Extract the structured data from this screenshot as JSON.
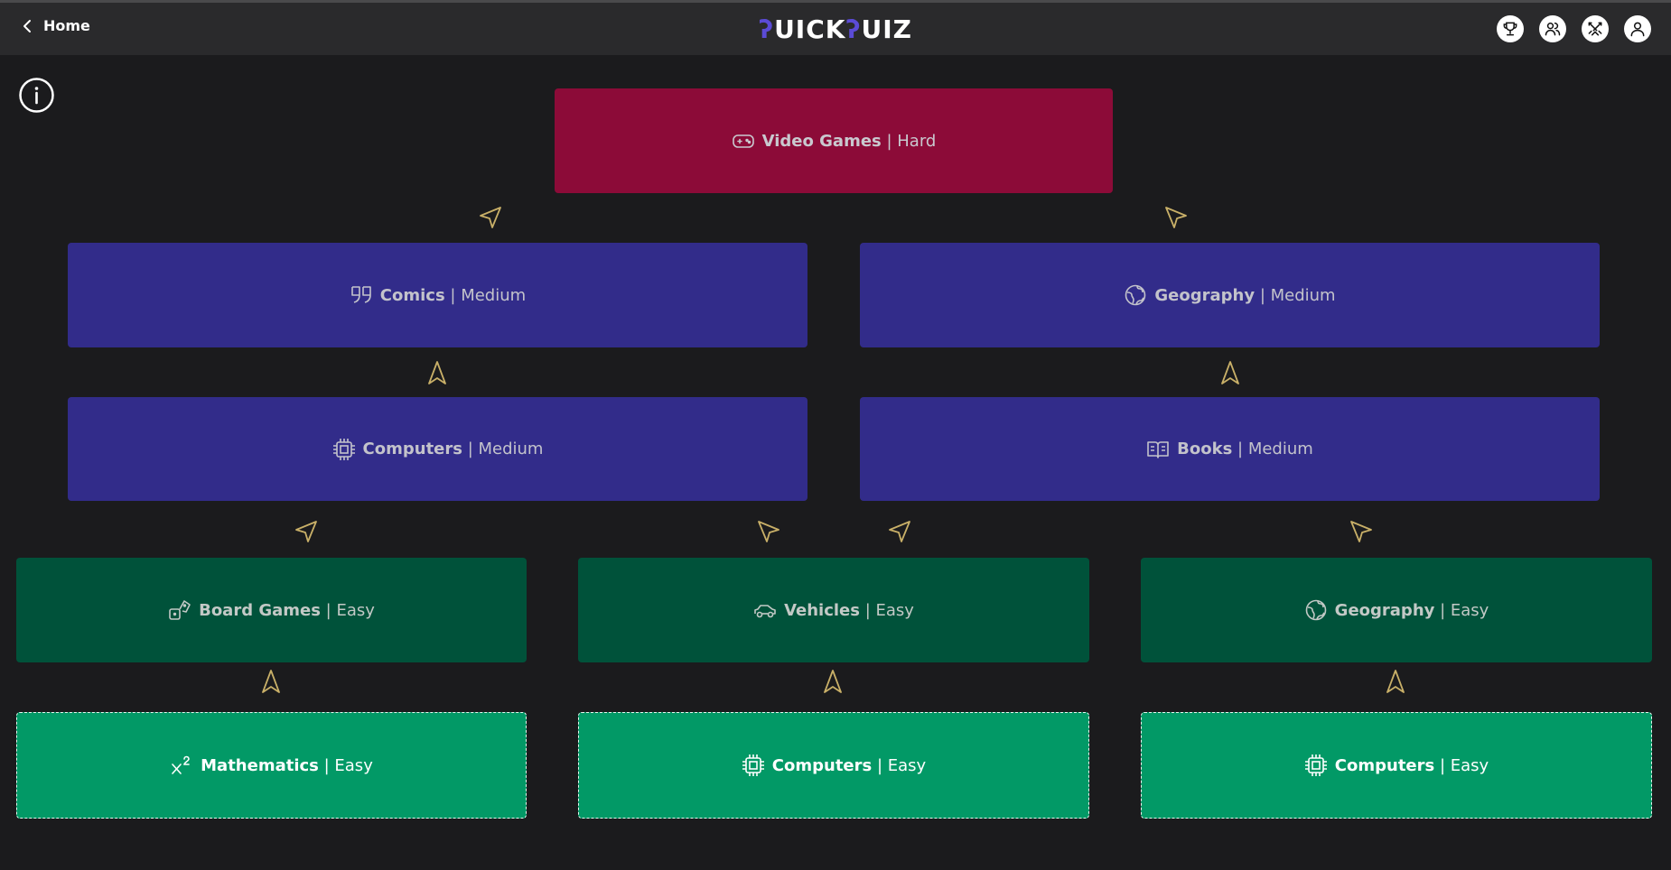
{
  "header": {
    "home_label": "Home",
    "logo": {
      "q1": "ʔ",
      "part1": "UICK",
      "q2": "ʔ",
      "part2": "UIZ"
    },
    "nav_icons": [
      "trophy-icon",
      "users-icon",
      "swords-icon",
      "user-icon"
    ]
  },
  "colors": {
    "hard": "#8c0b38",
    "medium": "#322c8a",
    "easy": "#00523a",
    "start": "#029966",
    "arrow": "#c9b068",
    "accent": "#5b4bd6"
  },
  "nodes": {
    "video_games": {
      "name": "Video Games",
      "level": "Hard",
      "icon": "gamepad-icon"
    },
    "comics": {
      "name": "Comics",
      "level": "Medium",
      "icon": "quote-icon"
    },
    "geography_med": {
      "name": "Geography",
      "level": "Medium",
      "icon": "globe-icon"
    },
    "computers_med": {
      "name": "Computers",
      "level": "Medium",
      "icon": "cpu-icon"
    },
    "books": {
      "name": "Books",
      "level": "Medium",
      "icon": "book-icon"
    },
    "board_games": {
      "name": "Board Games",
      "level": "Easy",
      "icon": "dice-icon"
    },
    "vehicles": {
      "name": "Vehicles",
      "level": "Easy",
      "icon": "car-icon"
    },
    "geography_easy": {
      "name": "Geography",
      "level": "Easy",
      "icon": "globe-icon"
    },
    "mathematics": {
      "name": "Mathematics",
      "level": "Easy",
      "icon": "superscript-icon"
    },
    "computers_easy_1": {
      "name": "Computers",
      "level": "Easy",
      "icon": "cpu-icon"
    },
    "computers_easy_2": {
      "name": "Computers",
      "level": "Easy",
      "icon": "cpu-icon"
    }
  },
  "separator": " | "
}
